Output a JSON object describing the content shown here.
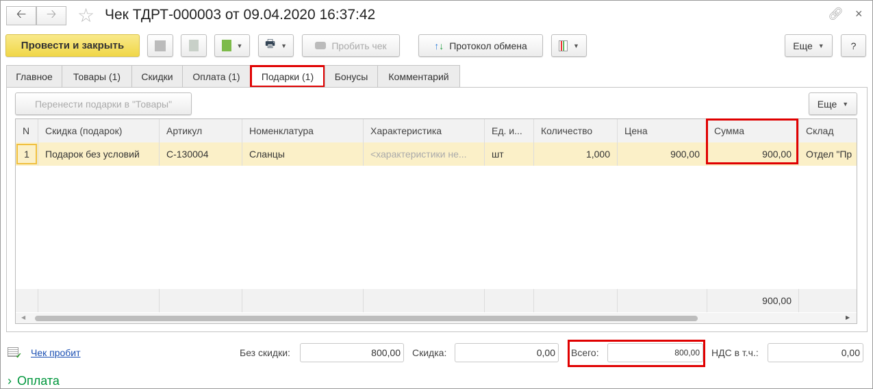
{
  "title": "Чек ТДРТ-000003 от 09.04.2020 16:37:42",
  "toolbar": {
    "post_close": "Провести и закрыть",
    "print_check": "Пробить чек",
    "exchange_log": "Протокол обмена",
    "more": "Еще",
    "help": "?"
  },
  "tabs": [
    "Главное",
    "Товары (1)",
    "Скидки",
    "Оплата (1)",
    "Подарки (1)",
    "Бонусы",
    "Комментарий"
  ],
  "gifts": {
    "move_button": "Перенести подарки в \"Товары\"",
    "more": "Еще",
    "columns": [
      "N",
      "Скидка (подарок)",
      "Артикул",
      "Номенклатура",
      "Характеристика",
      "Ед. и...",
      "Количество",
      "Цена",
      "Сумма",
      "Склад"
    ],
    "rows": [
      [
        "1",
        "Подарок без условий",
        "С-130004",
        "Сланцы",
        "<характеристики не...",
        "шт",
        "1,000",
        "900,00",
        "900,00",
        "Отдел \"Пр"
      ]
    ],
    "total_sum": "900,00"
  },
  "footer": {
    "check_status": "Чек пробит",
    "no_discount_label": "Без скидки:",
    "no_discount": "800,00",
    "discount_label": "Скидка:",
    "discount": "0,00",
    "total_label": "Всего:",
    "total": "800,00",
    "vat_label": "НДС в т.ч.:",
    "vat": "0,00",
    "payment_section": "Оплата"
  },
  "colors": {
    "accent_yellow": "#f5de5a",
    "highlight": "#e00000",
    "row": "#fbf0c8",
    "link": "#1a4fb3",
    "green": "#00963c"
  }
}
